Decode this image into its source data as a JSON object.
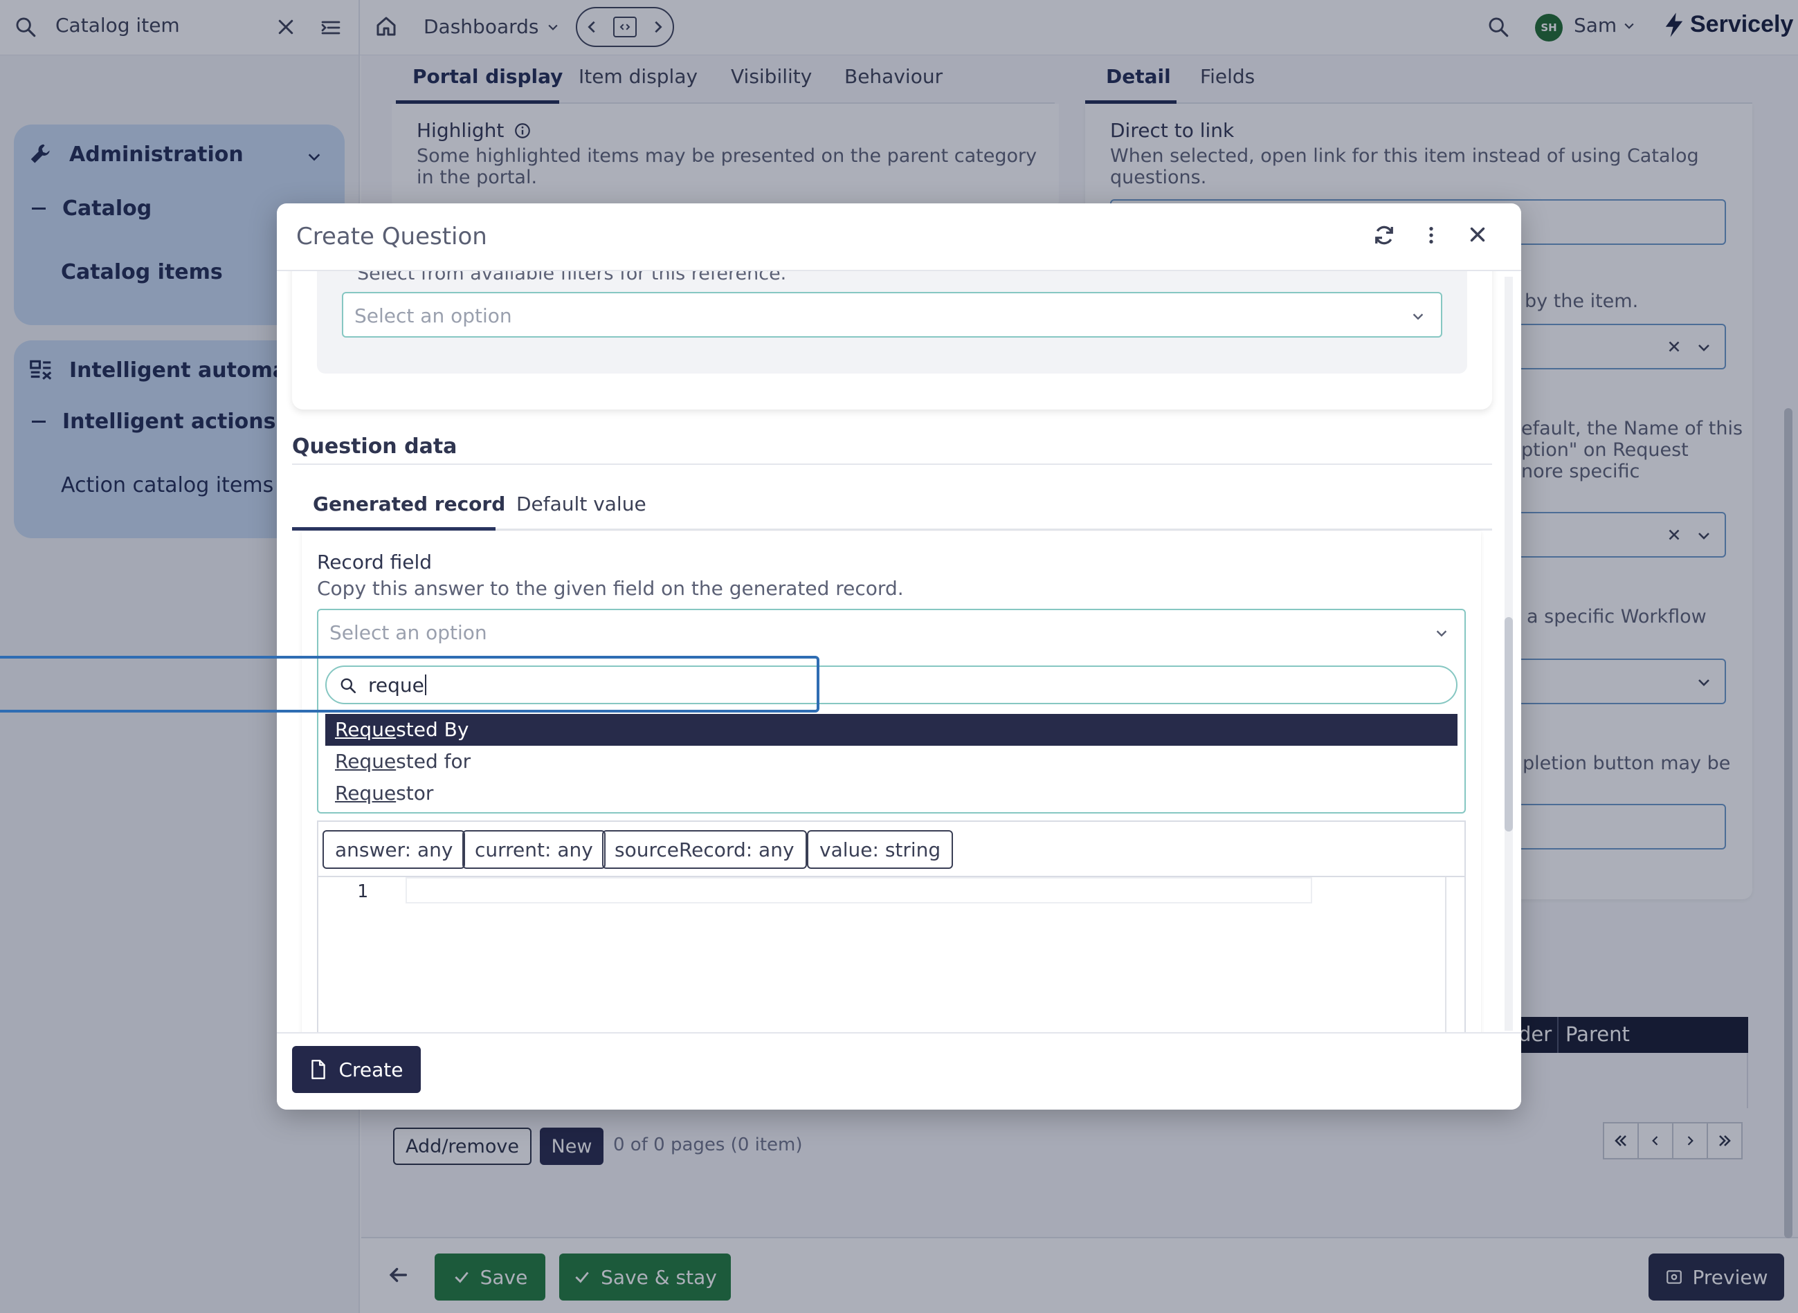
{
  "topbar": {
    "search_value": "Catalog item",
    "dashboards_label": "Dashboards",
    "user_initials": "SH",
    "user_name": "Sam",
    "brand": "Servicely"
  },
  "sidebar": {
    "group1": {
      "title": "Administration",
      "sub": "Catalog",
      "item": "Catalog items"
    },
    "group2": {
      "title": "Intelligent automatio",
      "sub": "Intelligent actions",
      "item": "Action catalog items"
    }
  },
  "main": {
    "left_tabs": [
      "Portal display",
      "Item display",
      "Visibility",
      "Behaviour"
    ],
    "right_tabs": [
      "Detail",
      "Fields"
    ],
    "highlight_label": "Highlight",
    "highlight_hint_1": "Some highlighted items may be presented on the parent category",
    "highlight_hint_2": "in the portal.",
    "direct_label": "Direct to link",
    "direct_hint_1": "When selected, open link for this item instead of using Catalog",
    "direct_hint_2": "questions.",
    "frag_by_item": "by the item.",
    "frag_default_1": "efault, the Name of this",
    "frag_default_2": "ption\" on Request",
    "frag_default_3": "nore specific",
    "frag_workflow": "a specific Workflow",
    "frag_completion": "pletion button may be",
    "table_headers": [
      "der",
      "Parent"
    ],
    "add_remove_label": "Add/remove",
    "new_label": "New",
    "pages_text": "0 of 0 pages (0 item)"
  },
  "footer": {
    "save_label": "Save",
    "save_stay_label": "Save & stay",
    "preview_label": "Preview"
  },
  "modal": {
    "title": "Create Question",
    "filter_hint": "Select from available filters for this reference.",
    "filter_placeholder": "Select an option",
    "question_data_title": "Question data",
    "tabs": [
      "Generated record",
      "Default value"
    ],
    "record_field_label": "Record field",
    "record_field_hint": "Copy this answer to the given field on the generated record.",
    "record_field_placeholder": "Select an option",
    "search_query": "reque",
    "options": [
      {
        "match": "Reque",
        "rest": "sted By"
      },
      {
        "match": "Reque",
        "rest": "sted for"
      },
      {
        "match": "Reque",
        "rest": "stor"
      }
    ],
    "variables": [
      "answer: any",
      "current: any",
      "sourceRecord: any",
      "value: string"
    ],
    "line_number": "1",
    "create_label": "Create"
  }
}
